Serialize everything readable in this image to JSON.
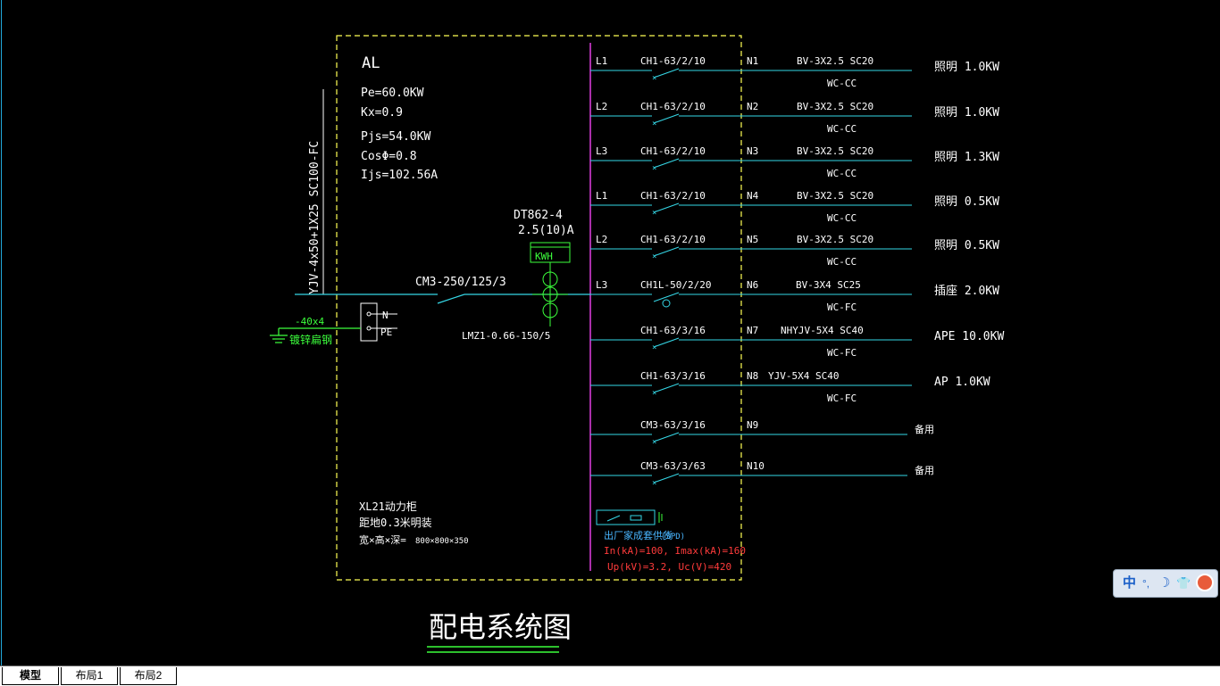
{
  "panel": {
    "name": "AL",
    "params": [
      "Pe=60.0KW",
      "Kx=0.9",
      "Pjs=54.0KW",
      "CosΦ=0.8",
      "Ijs=102.56A"
    ],
    "incoming_cable": "YJV-4x50+1X25 SC100-FC",
    "main_breaker": "CM3-250/125/3",
    "meter_model": "DT862-4",
    "meter_rating": "2.5(10)A",
    "meter_box": "KWH",
    "ct": "LMZ1-0.66-150/5",
    "n_label": "N",
    "pe_label": "PE",
    "ground_size": "-40x4",
    "ground_text": "镀锌扁钢",
    "cabinet_lines": [
      "XL21动力柜",
      "距地0.3米明装",
      "宽×高×深=",
      "800×800×350"
    ],
    "spd_label": "出厂家成套供货",
    "spd_tag": "(SPD)",
    "spd_spec1": "In(kA)=100, Imax(kA)=160",
    "spd_spec2": "Up(kV)=3.2, Uc(V)=420"
  },
  "circuits": [
    {
      "phase": "L1",
      "breaker": "CH1-63/2/10",
      "num": "N1",
      "cable": "BV-3X2.5  SC20",
      "laying": "WC-CC",
      "load": "照明 1.0KW"
    },
    {
      "phase": "L2",
      "breaker": "CH1-63/2/10",
      "num": "N2",
      "cable": "BV-3X2.5  SC20",
      "laying": "WC-CC",
      "load": "照明 1.0KW"
    },
    {
      "phase": "L3",
      "breaker": "CH1-63/2/10",
      "num": "N3",
      "cable": "BV-3X2.5  SC20",
      "laying": "WC-CC",
      "load": "照明 1.3KW"
    },
    {
      "phase": "L1",
      "breaker": "CH1-63/2/10",
      "num": "N4",
      "cable": "BV-3X2.5  SC20",
      "laying": "WC-CC",
      "load": "照明 0.5KW"
    },
    {
      "phase": "L2",
      "breaker": "CH1-63/2/10",
      "num": "N5",
      "cable": "BV-3X2.5  SC20",
      "laying": "WC-CC",
      "load": "照明 0.5KW"
    },
    {
      "phase": "L3",
      "breaker": "CH1L-50/2/20",
      "num": "N6",
      "cable": "BV-3X4  SC25",
      "laying": "WC-FC",
      "load": "插座 2.0KW"
    },
    {
      "phase": "",
      "breaker": "CH1-63/3/16",
      "num": "N7",
      "cable": "NHYJV-5X4  SC40",
      "laying": "WC-FC",
      "load": "APE 10.0KW"
    },
    {
      "phase": "",
      "breaker": "CH1-63/3/16",
      "num": "N8",
      "cable": "YJV-5X4  SC40",
      "laying": "WC-FC",
      "load": "AP 1.0KW"
    },
    {
      "phase": "",
      "breaker": "CM3-63/3/16",
      "num": "N9",
      "cable": "",
      "laying": "",
      "load": "备用"
    },
    {
      "phase": "",
      "breaker": "CM3-63/3/63",
      "num": "N10",
      "cable": "",
      "laying": "",
      "load": "备用"
    }
  ],
  "drawing_title": "配电系统图",
  "tabs": [
    "模型",
    "布局1",
    "布局2"
  ],
  "ime": {
    "lang": "中",
    "punct": "°,",
    "moon": "☽",
    "shirt": "👕"
  },
  "colors": {
    "cyan": "#35d7e6",
    "green": "#3cff3c",
    "yellow": "#ffff55",
    "white": "#ffffff",
    "magenta": "#e23fe2",
    "red": "#ff3b3b",
    "blue": "#49b6ff"
  }
}
